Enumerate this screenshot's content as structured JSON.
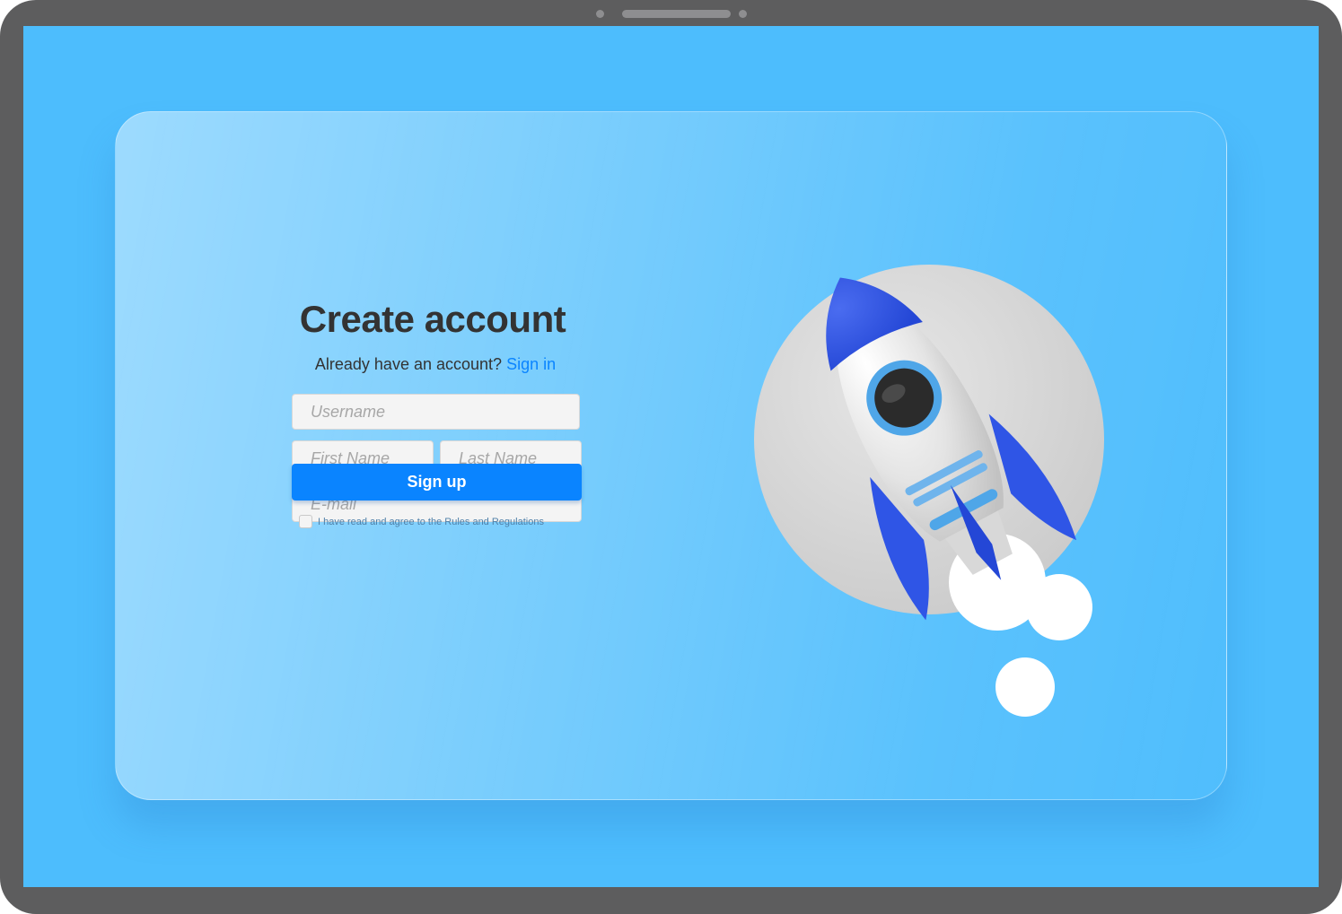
{
  "signup": {
    "title": "Create account",
    "subtitle_prefix": "Already have an account?",
    "signin_link": "Sign in",
    "username_placeholder": "Username",
    "first_name_placeholder": "First Name",
    "last_name_placeholder": "Last Name",
    "email_placeholder": "E-mail",
    "signup_button": "Sign up",
    "agree_text": "I have read and agree to the Rules and Regulations"
  },
  "colors": {
    "background": "#4dbdfd",
    "accent": "#0a84ff",
    "heading": "#333333",
    "device_frame": "#5d5d5e"
  },
  "illustration": "rocket-icon"
}
